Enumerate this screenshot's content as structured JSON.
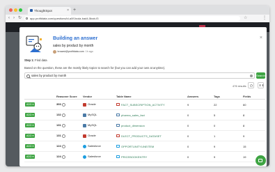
{
  "browser": {
    "tab_title": "ThoughtSpot",
    "new_tab": "+",
    "url": "app.profitdata.com/questions/id-a0f1bcda-bad4-5bab-f3",
    "nav_back": "‹",
    "nav_forward": "›",
    "nav_reload": "↻",
    "bookmark": "☆",
    "menu": "⋮"
  },
  "modal": {
    "title": "Building an answer",
    "subtitle": "sales by product by month",
    "author_email": "brownd@profitdata.com",
    "author_time": "1h ago",
    "step_label": "Step 1:",
    "step_text": "Find data",
    "description": "Based on the question, these are the mostly likely topics to search for (but you can add your own at anytime).",
    "search_value": "sales by product by month",
    "search_button": "Search",
    "results_count": "476 results",
    "close": "×"
  },
  "table": {
    "headers": [
      "",
      "Reasoner Score",
      "Vendor",
      "Table Name",
      "Answers",
      "Tags",
      "Fields"
    ],
    "add_label": "ADD",
    "rows": [
      {
        "score": "393",
        "vendor": "Oracle",
        "table": "FACT_SUBSCRIPTION_ACTIVITY",
        "answers": "9",
        "tags": "22",
        "fields": "60"
      },
      {
        "score": "132",
        "vendor": "MySQL",
        "table": "pharma_sales_fact",
        "answers": "0",
        "tags": "5",
        "fields": "8"
      },
      {
        "score": "131",
        "vendor": "MySQL",
        "table": "product_dimension",
        "answers": "0",
        "tags": "0",
        "fields": "8"
      },
      {
        "score": "131",
        "vendor": "Oracle",
        "table": "DLECT_PRODUCTS_DATASET",
        "answers": "0",
        "tags": "1",
        "fields": "9"
      },
      {
        "score": "124",
        "vendor": "Salesforce",
        "table": "OPPORTUNITYLINEITEM",
        "answers": "0",
        "tags": "9",
        "fields": "15"
      },
      {
        "score": "124",
        "vendor": "Salesforce",
        "table": "PRICEBOOKENTRY",
        "answers": "0",
        "tags": "9",
        "fields": "19"
      }
    ]
  },
  "colors": {
    "accent_blue": "#2d6fd0",
    "add_green": "#3ea443",
    "oracle": "#c23b2f",
    "mysql": "#4a7aa6",
    "salesforce": "#1d9ee0"
  },
  "icons": [
    "thoughtspot-logo",
    "search-icon",
    "clear-icon",
    "gear-icon",
    "columns-icon",
    "info-icon",
    "chat-icon",
    "table-icon"
  ]
}
